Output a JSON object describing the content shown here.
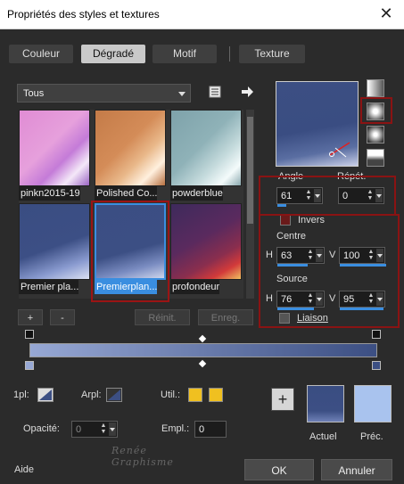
{
  "window": {
    "title": "Propriétés des styles et textures",
    "close_glyph": "✕"
  },
  "tabs": [
    {
      "label": "Couleur",
      "active": false
    },
    {
      "label": "Dégradé",
      "active": true
    },
    {
      "label": "Motif",
      "active": false
    },
    {
      "label": "Texture",
      "active": false
    }
  ],
  "category_dropdown": {
    "value": "Tous"
  },
  "thumbnails": [
    {
      "label": "pinkn2015-19"
    },
    {
      "label": "Polished Co..."
    },
    {
      "label": "powderblue"
    },
    {
      "label": "Premier pla..."
    },
    {
      "label": "Premierplan...",
      "selected": true
    },
    {
      "label": "profondeur"
    }
  ],
  "list_buttons": {
    "add": "+",
    "remove": "-",
    "reset": "Réinit.",
    "save": "Enreg."
  },
  "angle": {
    "label": "Angle",
    "value": "61"
  },
  "repeat": {
    "label": "Répét.",
    "value": "0"
  },
  "invert": {
    "label": "Invers"
  },
  "center": {
    "label": "Centre",
    "h_label": "H",
    "h_value": "63",
    "v_label": "V",
    "v_value": "100"
  },
  "source": {
    "label": "Source",
    "h_label": "H",
    "h_value": "76",
    "v_label": "V",
    "v_value": "95"
  },
  "link": {
    "label": "Liaison"
  },
  "stops": {
    "first_label": "1pl:",
    "last_label": "Arpl:",
    "user_label": "Util.:",
    "opacity_label": "Opacité:",
    "opacity_value": "0",
    "location_label": "Empl.:",
    "location_value": "0"
  },
  "colors": {
    "gradient_start": "#97a8d4",
    "gradient_end": "#3c4f83",
    "user_color": "#f0c020",
    "current_color": "#3c4f83",
    "previous_color": "#a9c3ee",
    "accent": "#3a8ee0",
    "highlight_red": "#8a1313"
  },
  "current_label": "Actuel",
  "previous_label": "Préc.",
  "add_color_glyph": "+",
  "footer": {
    "help": "Aide",
    "ok": "OK",
    "cancel": "Annuler"
  },
  "watermark": {
    "line1": "Renée",
    "line2": "Graphisme"
  }
}
